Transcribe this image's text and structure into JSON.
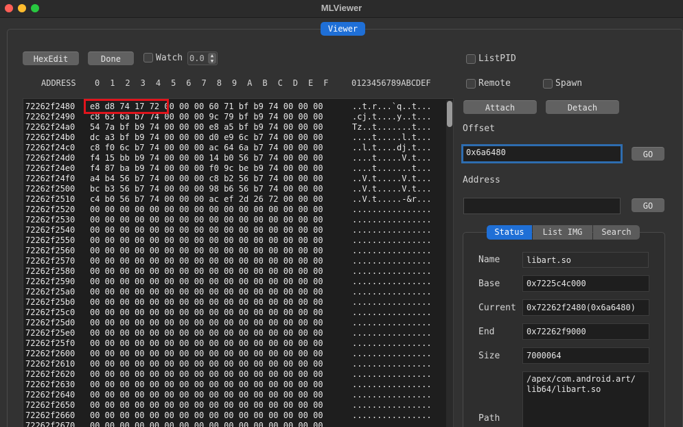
{
  "window": {
    "title": "MLViewer"
  },
  "tab": {
    "label": "Viewer"
  },
  "toolbar": {
    "hexedit": "HexEdit",
    "done": "Done",
    "watch": "Watch",
    "watch_value": "0.0"
  },
  "options": {
    "listpid": "ListPID",
    "remote": "Remote",
    "spawn": "Spawn"
  },
  "actions": {
    "attach": "Attach",
    "detach": "Detach"
  },
  "offset": {
    "label": "Offset",
    "value": "0x6a6480",
    "go": "GO"
  },
  "address": {
    "label": "Address",
    "value": "",
    "go": "GO"
  },
  "tabs": [
    "Status",
    "List IMG",
    "Search"
  ],
  "status": {
    "name_label": "Name",
    "name": "libart.so",
    "base_label": "Base",
    "base": "0x7225c4c000",
    "current_label": "Current",
    "current": "0x72262f2480(0x6a6480)",
    "end_label": "End",
    "end": "0x72262f9000",
    "size_label": "Size",
    "size": "7000064",
    "path_label": "Path",
    "path": "/apex/com.android.art/\nlib64/libart.so"
  },
  "hexview": {
    "header_address": "ADDRESS",
    "header_cols": "0  1  2  3  4  5  6  7  8  9  A  B  C  D  E  F",
    "header_ascii": "0123456789ABCDEF",
    "rows": [
      {
        "addr": "72262f2480",
        "hex": "e8 d8 74 17 72 00 00 00 60 71 bf b9 74 00 00 00",
        "ascii": "..t.r...`q..t..."
      },
      {
        "addr": "72262f2490",
        "hex": "c8 63 6a b7 74 00 00 00 9c 79 bf b9 74 00 00 00",
        "ascii": ".cj.t....y..t..."
      },
      {
        "addr": "72262f24a0",
        "hex": "54 7a bf b9 74 00 00 00 e8 a5 bf b9 74 00 00 00",
        "ascii": "Tz..t.......t..."
      },
      {
        "addr": "72262f24b0",
        "hex": "dc a3 bf b9 74 00 00 00 d0 e9 6c b7 74 00 00 00",
        "ascii": "....t.....l.t..."
      },
      {
        "addr": "72262f24c0",
        "hex": "c8 f0 6c b7 74 00 00 00 ac 64 6a b7 74 00 00 00",
        "ascii": "..l.t....dj.t..."
      },
      {
        "addr": "72262f24d0",
        "hex": "f4 15 bb b9 74 00 00 00 14 b0 56 b7 74 00 00 00",
        "ascii": "....t.....V.t..."
      },
      {
        "addr": "72262f24e0",
        "hex": "f4 87 ba b9 74 00 00 00 f0 9c be b9 74 00 00 00",
        "ascii": "....t.......t..."
      },
      {
        "addr": "72262f24f0",
        "hex": "a4 b4 56 b7 74 00 00 00 c8 b2 56 b7 74 00 00 00",
        "ascii": "..V.t.....V.t..."
      },
      {
        "addr": "72262f2500",
        "hex": "bc b3 56 b7 74 00 00 00 98 b6 56 b7 74 00 00 00",
        "ascii": "..V.t.....V.t..."
      },
      {
        "addr": "72262f2510",
        "hex": "c4 b0 56 b7 74 00 00 00 ac ef 2d 26 72 00 00 00",
        "ascii": "..V.t.....-&r..."
      },
      {
        "addr": "72262f2520",
        "hex": "00 00 00 00 00 00 00 00 00 00 00 00 00 00 00 00",
        "ascii": "................"
      },
      {
        "addr": "72262f2530",
        "hex": "00 00 00 00 00 00 00 00 00 00 00 00 00 00 00 00",
        "ascii": "................"
      },
      {
        "addr": "72262f2540",
        "hex": "00 00 00 00 00 00 00 00 00 00 00 00 00 00 00 00",
        "ascii": "................"
      },
      {
        "addr": "72262f2550",
        "hex": "00 00 00 00 00 00 00 00 00 00 00 00 00 00 00 00",
        "ascii": "................"
      },
      {
        "addr": "72262f2560",
        "hex": "00 00 00 00 00 00 00 00 00 00 00 00 00 00 00 00",
        "ascii": "................"
      },
      {
        "addr": "72262f2570",
        "hex": "00 00 00 00 00 00 00 00 00 00 00 00 00 00 00 00",
        "ascii": "................"
      },
      {
        "addr": "72262f2580",
        "hex": "00 00 00 00 00 00 00 00 00 00 00 00 00 00 00 00",
        "ascii": "................"
      },
      {
        "addr": "72262f2590",
        "hex": "00 00 00 00 00 00 00 00 00 00 00 00 00 00 00 00",
        "ascii": "................"
      },
      {
        "addr": "72262f25a0",
        "hex": "00 00 00 00 00 00 00 00 00 00 00 00 00 00 00 00",
        "ascii": "................"
      },
      {
        "addr": "72262f25b0",
        "hex": "00 00 00 00 00 00 00 00 00 00 00 00 00 00 00 00",
        "ascii": "................"
      },
      {
        "addr": "72262f25c0",
        "hex": "00 00 00 00 00 00 00 00 00 00 00 00 00 00 00 00",
        "ascii": "................"
      },
      {
        "addr": "72262f25d0",
        "hex": "00 00 00 00 00 00 00 00 00 00 00 00 00 00 00 00",
        "ascii": "................"
      },
      {
        "addr": "72262f25e0",
        "hex": "00 00 00 00 00 00 00 00 00 00 00 00 00 00 00 00",
        "ascii": "................"
      },
      {
        "addr": "72262f25f0",
        "hex": "00 00 00 00 00 00 00 00 00 00 00 00 00 00 00 00",
        "ascii": "................"
      },
      {
        "addr": "72262f2600",
        "hex": "00 00 00 00 00 00 00 00 00 00 00 00 00 00 00 00",
        "ascii": "................"
      },
      {
        "addr": "72262f2610",
        "hex": "00 00 00 00 00 00 00 00 00 00 00 00 00 00 00 00",
        "ascii": "................"
      },
      {
        "addr": "72262f2620",
        "hex": "00 00 00 00 00 00 00 00 00 00 00 00 00 00 00 00",
        "ascii": "................"
      },
      {
        "addr": "72262f2630",
        "hex": "00 00 00 00 00 00 00 00 00 00 00 00 00 00 00 00",
        "ascii": "................"
      },
      {
        "addr": "72262f2640",
        "hex": "00 00 00 00 00 00 00 00 00 00 00 00 00 00 00 00",
        "ascii": "................"
      },
      {
        "addr": "72262f2650",
        "hex": "00 00 00 00 00 00 00 00 00 00 00 00 00 00 00 00",
        "ascii": "................"
      },
      {
        "addr": "72262f2660",
        "hex": "00 00 00 00 00 00 00 00 00 00 00 00 00 00 00 00",
        "ascii": "................"
      },
      {
        "addr": "72262f2670",
        "hex": "00 00 00 00 00 00 00 00 00 00 00 00 00 00 00 00",
        "ascii": "................"
      }
    ]
  },
  "colors": {
    "accent": "#1f6fd6",
    "highlight": "#e0141c",
    "background": "#323232",
    "dump_bg": "#1e1e1e"
  }
}
